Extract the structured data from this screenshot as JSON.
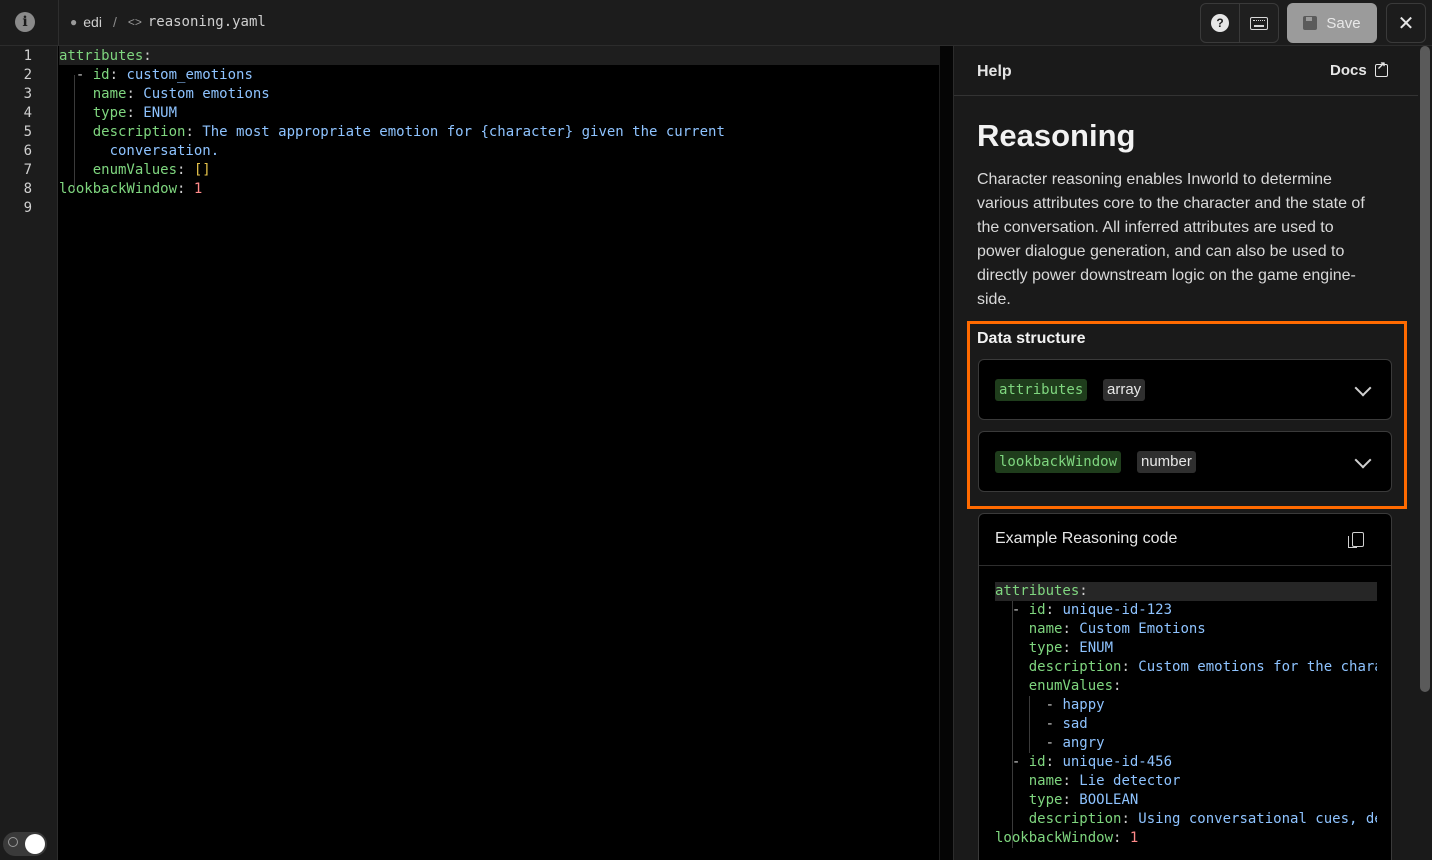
{
  "topbar": {
    "user": "edi",
    "separator": "/",
    "file": "reasoning.yaml",
    "save_label": "Save",
    "help_glyph": "?",
    "close_glyph": "✕",
    "info_glyph": "i"
  },
  "editor": {
    "line_numbers": [
      "1",
      "2",
      "3",
      "4",
      "5",
      "6",
      "7",
      "8",
      "9"
    ]
  },
  "help_panel": {
    "title": "Help",
    "docs_label": "Docs",
    "heading": "Reasoning",
    "description": "Character reasoning enables Inworld to determine various attributes core to the character and the state of the conversation. All inferred attributes are used to power dialogue generation, and can also be used to directly power downstream logic on the game engine-side.",
    "data_structure_title": "Data structure",
    "fields": [
      {
        "key": "attributes",
        "type": "array"
      },
      {
        "key": "lookbackWindow",
        "type": "number"
      }
    ],
    "example_title": "Example Reasoning code"
  },
  "colors": {
    "accent_highlight": "#ff6a00",
    "key_green": "#7fd67f",
    "value_blue": "#8ec3ff",
    "number_red": "#ff8a8a"
  }
}
